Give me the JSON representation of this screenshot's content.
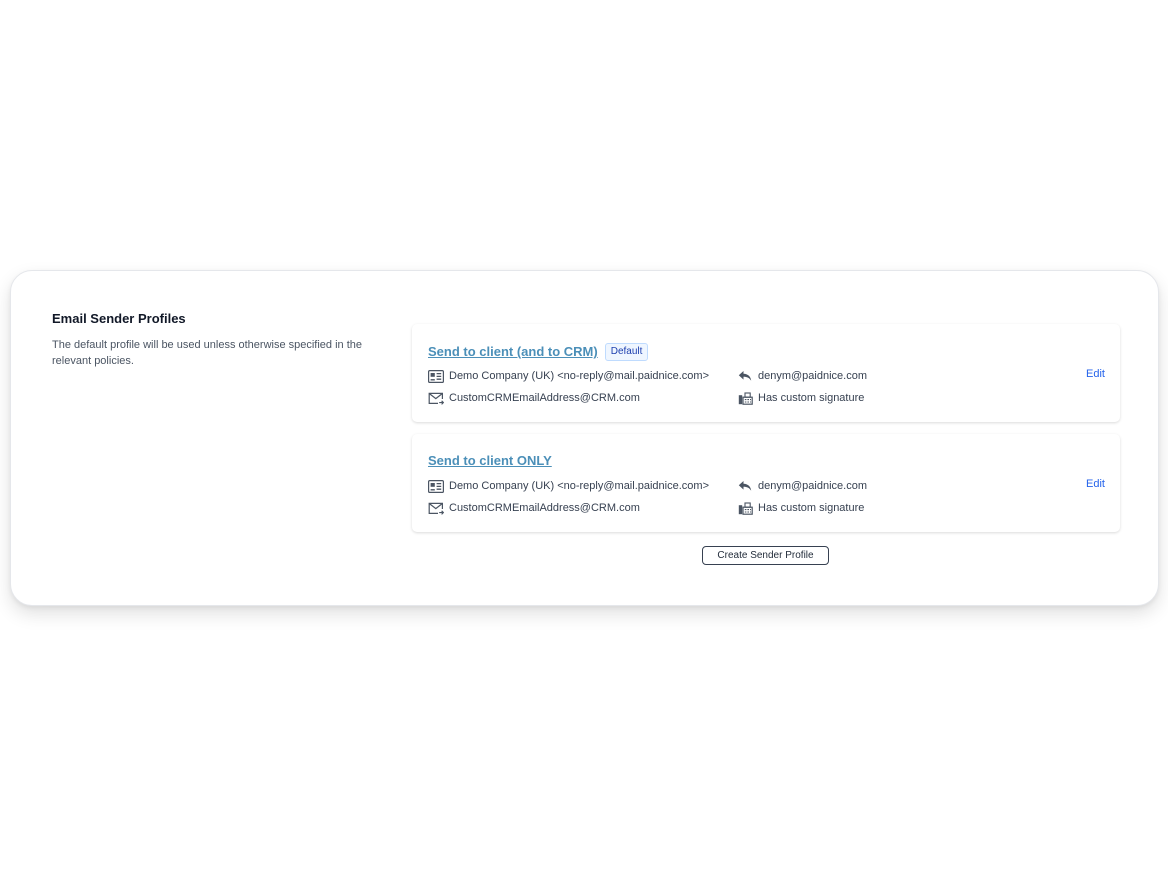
{
  "section": {
    "title": "Email Sender Profiles",
    "description": "The default profile will be used unless otherwise specified in the relevant policies."
  },
  "profiles": [
    {
      "name": "Send to client (and to CRM)",
      "badge": "Default",
      "from": "Demo Company (UK) <no-reply@mail.paidnice.com>",
      "reply_to": "denym@paidnice.com",
      "bcc": "CustomCRMEmailAddress@CRM.com",
      "signature": "Has custom signature",
      "edit_label": "Edit"
    },
    {
      "name": "Send to client ONLY",
      "badge": "",
      "from": "Demo Company (UK) <no-reply@mail.paidnice.com>",
      "reply_to": "denym@paidnice.com",
      "bcc": "CustomCRMEmailAddress@CRM.com",
      "signature": "Has custom signature",
      "edit_label": "Edit"
    }
  ],
  "actions": {
    "create_label": "Create Sender Profile"
  },
  "icons": {
    "from": "contact-card-icon",
    "reply_to": "reply-icon",
    "bcc": "mail-forward-icon",
    "signature": "fax-icon"
  },
  "colors": {
    "link": "#4b8fb8",
    "edit": "#2563eb",
    "badge_text": "#1e40af",
    "badge_bg": "#eff6ff"
  }
}
